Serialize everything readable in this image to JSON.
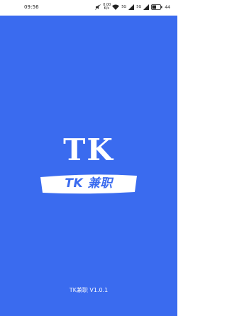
{
  "status_bar": {
    "time": "09:56",
    "network_speed_value": "0.00",
    "network_speed_unit": "K/s",
    "signal_label_1": "5G",
    "signal_label_2": "5G",
    "battery_percent": "44"
  },
  "splash": {
    "logo_text": "TK",
    "banner_text": "TK 兼职",
    "version_text": "TK兼职 V1.0.1",
    "background_color": "#3a6bef"
  },
  "icons": {
    "wifi": "wifi-icon",
    "signal": "signal-icon",
    "battery": "battery-icon",
    "mute": "silent-icon"
  }
}
